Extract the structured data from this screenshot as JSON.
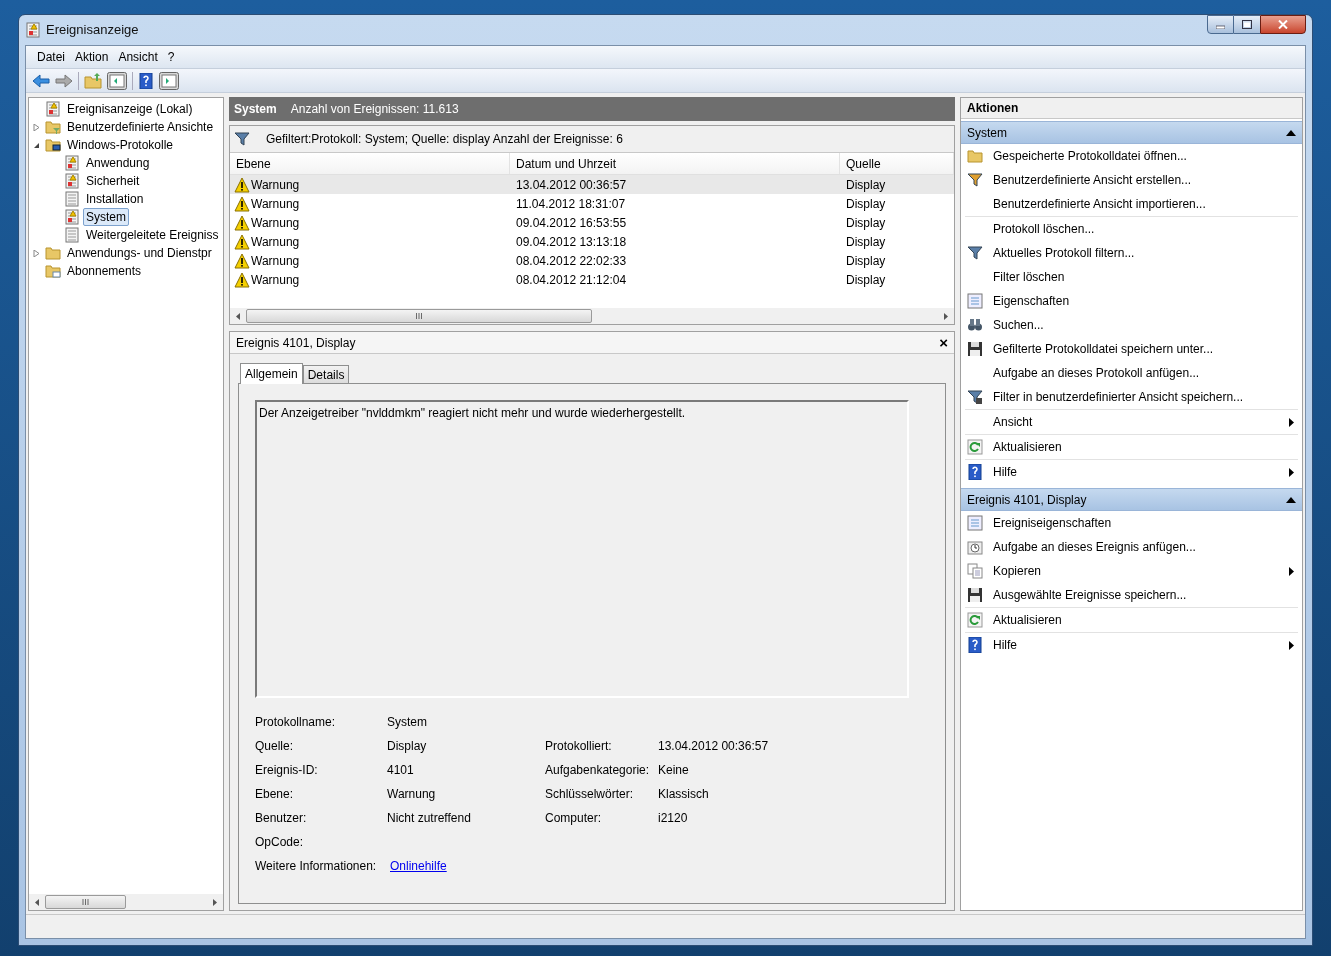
{
  "window": {
    "title": "Ereignisanzeige"
  },
  "menu": [
    "Datei",
    "Aktion",
    "Ansicht",
    "?"
  ],
  "tree": [
    {
      "label": "Ereignisanzeige (Lokal)",
      "kind": "root",
      "selected": false,
      "children": [
        {
          "label": "Benutzerdefinierte Ansichte",
          "kind": "folder-filter",
          "expanded": false,
          "selected": false
        },
        {
          "label": "Windows-Protokolle",
          "kind": "folder-pc",
          "expanded": true,
          "selected": false,
          "children": [
            {
              "label": "Anwendung",
              "kind": "log-warn",
              "selected": false
            },
            {
              "label": "Sicherheit",
              "kind": "log-warn",
              "selected": false
            },
            {
              "label": "Installation",
              "kind": "log",
              "selected": false
            },
            {
              "label": "System",
              "kind": "log-warn",
              "selected": true
            },
            {
              "label": "Weitergeleitete Ereigniss",
              "kind": "log",
              "selected": false
            }
          ]
        },
        {
          "label": "Anwendungs- und Dienstpr",
          "kind": "folder",
          "expanded": false,
          "selected": false
        },
        {
          "label": "Abonnements",
          "kind": "folder-sub",
          "selected": false
        }
      ]
    }
  ],
  "list": {
    "title": "System",
    "count": "Anzahl von Ereignissen: 11.613",
    "filter": "Gefiltert:Protokoll: System; Quelle: display Anzahl der Ereignisse: 6",
    "columns": [
      "Ebene",
      "Datum und Uhrzeit",
      "Quelle"
    ],
    "rows": [
      {
        "level": "Warnung",
        "date": "13.04.2012 00:36:57",
        "source": "Display",
        "selected": true
      },
      {
        "level": "Warnung",
        "date": "11.04.2012 18:31:07",
        "source": "Display",
        "selected": false
      },
      {
        "level": "Warnung",
        "date": "09.04.2012 16:53:55",
        "source": "Display",
        "selected": false
      },
      {
        "level": "Warnung",
        "date": "09.04.2012 13:13:18",
        "source": "Display",
        "selected": false
      },
      {
        "level": "Warnung",
        "date": "08.04.2012 22:02:33",
        "source": "Display",
        "selected": false
      },
      {
        "level": "Warnung",
        "date": "08.04.2012 21:12:04",
        "source": "Display",
        "selected": false
      }
    ],
    "scroll_grip": "III"
  },
  "detail": {
    "title": "Ereignis 4101, Display",
    "close": "×",
    "tabs": [
      {
        "label": "Allgemein",
        "selected": true
      },
      {
        "label": "Details",
        "selected": false
      }
    ],
    "message": "Der Anzeigetreiber \"nvlddmkm\" reagiert nicht mehr und wurde wiederhergestellt.",
    "fields": [
      [
        {
          "label": "Protokollname:",
          "value": "System"
        }
      ],
      [
        {
          "label": "Quelle:",
          "value": "Display"
        },
        {
          "label": "Protokolliert:",
          "value": "13.04.2012 00:36:57"
        }
      ],
      [
        {
          "label": "Ereignis-ID:",
          "value": "4101"
        },
        {
          "label": "Aufgabenkategorie:",
          "value": "Keine"
        }
      ],
      [
        {
          "label": "Ebene:",
          "value": "Warnung"
        },
        {
          "label": "Schlüsselwörter:",
          "value": "Klassisch"
        }
      ],
      [
        {
          "label": "Benutzer:",
          "value": "Nicht zutreffend"
        },
        {
          "label": "Computer:",
          "value": "i2120"
        }
      ],
      [
        {
          "label": "OpCode:"
        }
      ],
      [
        {
          "label": "Weitere Informationen:",
          "link": "Onlinehilfe"
        }
      ]
    ]
  },
  "tree_scroll_grip": "III",
  "actions": {
    "title": "Aktionen",
    "sections": [
      {
        "title": "System",
        "expanded": true,
        "groups": [
          [
            {
              "label": "Gespeicherte Protokolldatei öffnen...",
              "kind": "folder",
              "submenu": false
            },
            {
              "label": "Benutzerdefinierte Ansicht erstellen...",
              "kind": "filter-color",
              "submenu": false
            },
            {
              "label": "Benutzerdefinierte Ansicht importieren...",
              "kind": "none",
              "submenu": false
            }
          ],
          [
            {
              "label": "Protokoll löschen...",
              "kind": "none",
              "submenu": false
            },
            {
              "label": "Aktuelles Protokoll filtern...",
              "kind": "filter",
              "submenu": false
            },
            {
              "label": "Filter löschen",
              "kind": "none",
              "submenu": false
            },
            {
              "label": "Eigenschaften",
              "kind": "properties",
              "submenu": false
            },
            {
              "label": "Suchen...",
              "kind": "binoculars",
              "submenu": false
            },
            {
              "label": "Gefilterte Protokolldatei speichern unter...",
              "kind": "floppy",
              "submenu": false
            },
            {
              "label": "Aufgabe an dieses Protokoll anfügen...",
              "kind": "none",
              "submenu": false
            },
            {
              "label": "Filter in benutzerdefinierter Ansicht speichern...",
              "kind": "filter-save",
              "submenu": false
            }
          ],
          [
            {
              "label": "Ansicht",
              "kind": "none",
              "submenu": true
            }
          ],
          [
            {
              "label": "Aktualisieren",
              "kind": "refresh",
              "submenu": false
            }
          ],
          [
            {
              "label": "Hilfe",
              "kind": "help",
              "submenu": true
            }
          ]
        ]
      },
      {
        "title": "Ereignis 4101, Display",
        "expanded": true,
        "groups": [
          [
            {
              "label": "Ereigniseigenschaften",
              "kind": "properties",
              "submenu": false
            },
            {
              "label": "Aufgabe an dieses Ereignis anfügen...",
              "kind": "task",
              "submenu": false
            },
            {
              "label": "Kopieren",
              "kind": "copy",
              "submenu": true
            },
            {
              "label": "Ausgewählte Ereignisse speichern...",
              "kind": "floppy",
              "submenu": false
            }
          ],
          [
            {
              "label": "Aktualisieren",
              "kind": "refresh",
              "submenu": false
            }
          ],
          [
            {
              "label": "Hilfe",
              "kind": "help",
              "submenu": true
            }
          ]
        ]
      }
    ]
  }
}
